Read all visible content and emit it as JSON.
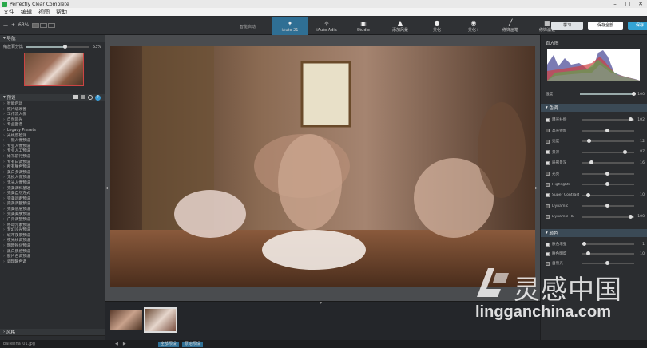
{
  "window": {
    "title": "Perfectly Clear Complete"
  },
  "menu": [
    "文件",
    "编辑",
    "视图",
    "帮助"
  ],
  "toolbar": {
    "minus": "—",
    "plus": "+",
    "zoom": "63%",
    "smart_select": "智能启动"
  },
  "presets": [
    {
      "label": "iAuto 21",
      "icon": "magic-wand-icon",
      "active": true
    },
    {
      "label": "iAuto Adia",
      "icon": "magic-wand-icon",
      "active": false
    },
    {
      "label": "Studio",
      "icon": "portrait-icon",
      "active": false
    },
    {
      "label": "添加风景",
      "icon": "landscape-icon",
      "active": false
    },
    {
      "label": "美化",
      "icon": "face-icon",
      "active": false
    },
    {
      "label": "美化+",
      "icon": "face-plus-icon",
      "active": false
    },
    {
      "label": "修饰画笔",
      "icon": "brush-icon",
      "active": false
    },
    {
      "label": "修饰滤镜",
      "icon": "grid-icon",
      "active": false
    }
  ],
  "top_buttons": {
    "learn": "学习",
    "save_all": "保存全部",
    "save": "保存"
  },
  "left": {
    "nav_title": "导航",
    "zoom_label": "缩放百分比",
    "zoom_value": "63%",
    "presets_title": "预设",
    "items": [
      "智能启动",
      "照片级改善",
      "工作流人像",
      "自然风光",
      "专业图谱",
      "Legacy Presets",
      "光线度检测",
      "一键人像预设",
      "专业人像预设",
      "专业人工预设",
      "婚礼前行预设",
      "专有白调预设",
      "所有肤色预设",
      "美白多调预设",
      "无损人像预设",
      "无光人像预设",
      "完美调料基础",
      "完美自然方式",
      "完美远距预设",
      "完美调整预设",
      "完美低层预设",
      "完美美肤预设",
      "户外调整预设",
      "移动元素预设",
      "梦幻冷光预设",
      "城市夜景预设",
      "夜光线调预设",
      "明暗锐化预设",
      "黑白质感预设",
      "胶片色调预设",
      "调理暖色调"
    ],
    "footer": "风格"
  },
  "right": {
    "histogram_title": "直方图",
    "exposure_label": "强度",
    "exposure_value": "100",
    "sections": {
      "tone": "色调",
      "color": "颜色"
    },
    "tone_rows": [
      {
        "label": "曝光补偿",
        "value": "102",
        "checked": true
      },
      {
        "label": "高光保留",
        "value": "",
        "checked": false
      },
      {
        "label": "亮度",
        "value": "12",
        "checked": false
      },
      {
        "label": "景深",
        "value": "87",
        "checked": true
      },
      {
        "label": "局部景深",
        "value": "16",
        "checked": true
      },
      {
        "label": "光亮",
        "value": "",
        "checked": false
      },
      {
        "label": "Highlights",
        "value": "",
        "checked": false
      },
      {
        "label": "Super Contrast",
        "value": "10",
        "checked": true
      },
      {
        "label": "Dynamic",
        "value": "",
        "checked": false
      },
      {
        "label": "Dynamic HL",
        "value": "100",
        "checked": false
      }
    ],
    "color_rows": [
      {
        "label": "肤色增强",
        "value": "1",
        "checked": true
      },
      {
        "label": "肤色明度",
        "value": "10",
        "checked": true
      },
      {
        "label": "自然光",
        "value": "",
        "checked": false
      }
    ]
  },
  "status": {
    "file": "ballerina_01.jpg",
    "tag1": "全部预设",
    "tag2": "原始预设"
  },
  "watermark": {
    "cn": "灵感中国",
    "url": "lingganchina.com"
  }
}
